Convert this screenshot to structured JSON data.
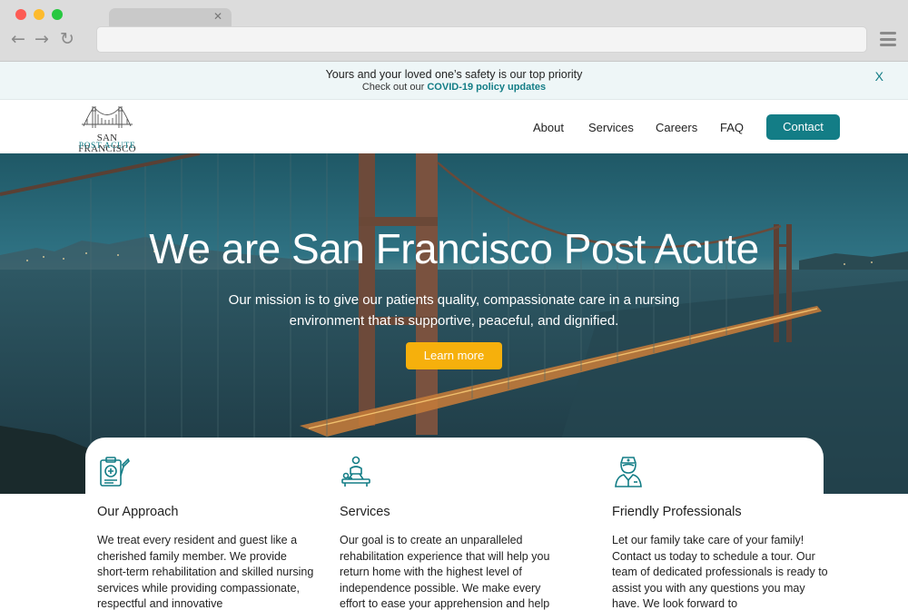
{
  "alert": {
    "title": "Yours and your loved one’s safety is our top priority",
    "sub_prefix": "Check out our ",
    "link": "COVID-19 policy updates",
    "close": "X"
  },
  "logo": {
    "line1": "SAN FRANCISCO",
    "line2": "POST ACUTE"
  },
  "nav": {
    "about": "About",
    "services": "Services",
    "careers": "Careers",
    "faq": "FAQ",
    "contact": "Contact"
  },
  "hero": {
    "title": "We are San Francisco Post Acute",
    "subtitle": "Our mission is to give our patients quality, compassionate care in a nursing environment that is supportive, peaceful, and dignified.",
    "button": "Learn more"
  },
  "cards": [
    {
      "icon": "clipboard-medical-icon",
      "title": "Our Approach",
      "text": "We treat every resident and guest like a cherished family member. We provide short-term rehabilitation and skilled nursing services while providing compassionate, respectful and innovative"
    },
    {
      "icon": "physical-therapy-icon",
      "title": "Services",
      "text": "Our goal is to create an unparalleled rehabilitation experience that will help you return home with the highest level of independence possible. We make every effort to ease your apprehension and help make the"
    },
    {
      "icon": "nurse-icon",
      "title": "Friendly Professionals",
      "text": "Let our family take care of your family! Contact us today to schedule a tour. Our team of dedicated professionals is ready to assist you with any questions you may have. We look forward to"
    }
  ],
  "colors": {
    "accent": "#137d86",
    "cta": "#f6b00c"
  }
}
